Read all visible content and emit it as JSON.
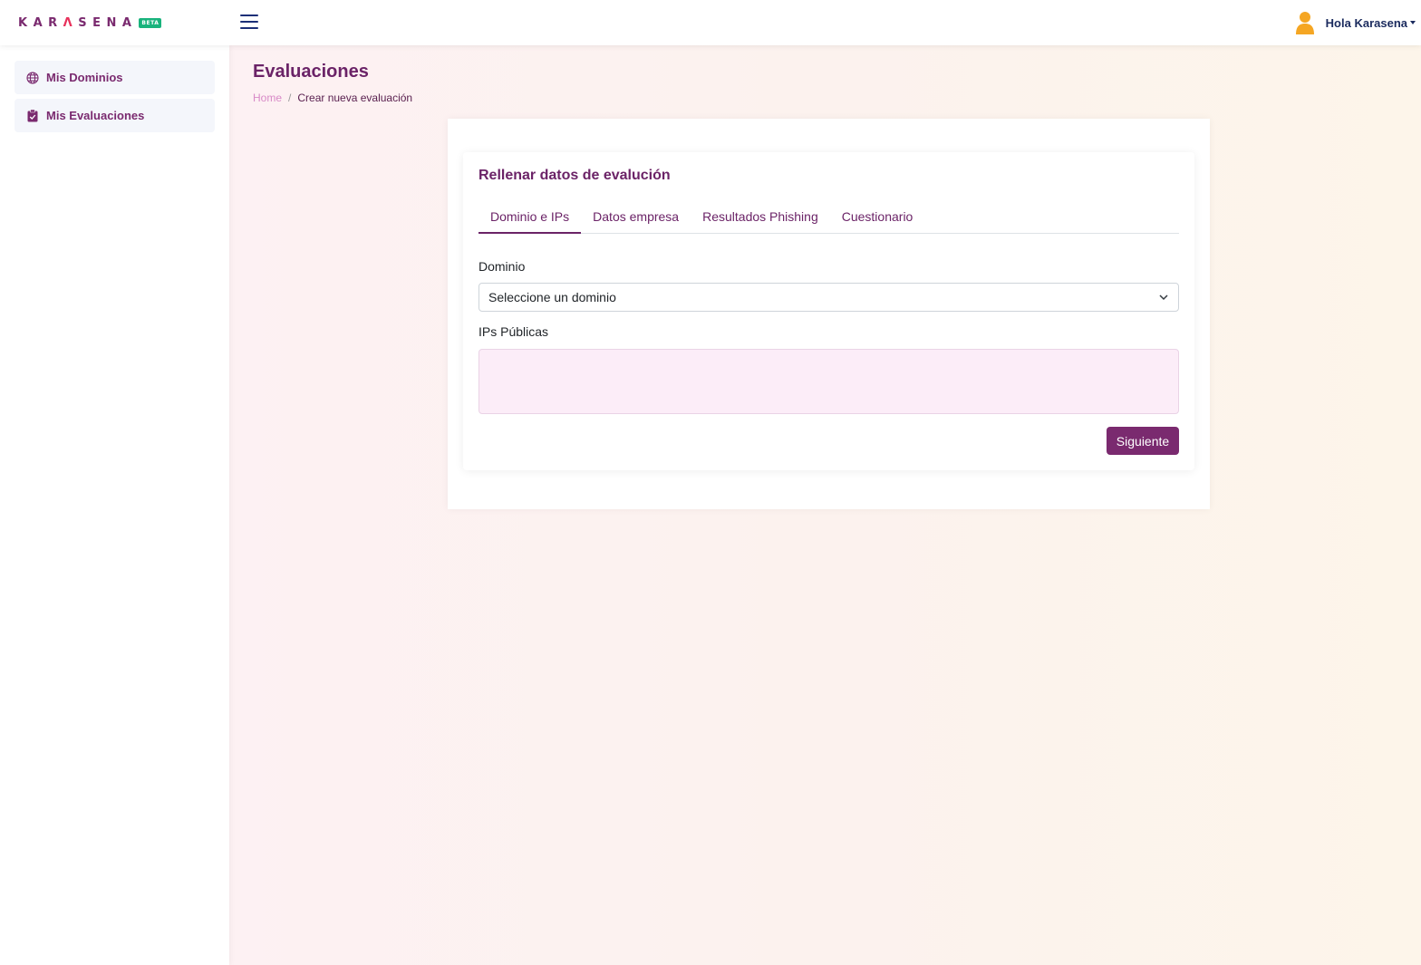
{
  "header": {
    "logo_before": "KAR",
    "logo_accent": "Λ",
    "logo_after": "SENA",
    "beta_badge": "BETA",
    "menu_icon": "hamburger-icon",
    "user_icon": "user-icon",
    "user_greeting": "Hola Karasena"
  },
  "sidebar": {
    "items": [
      {
        "label": "Mis Dominios",
        "icon": "globe-icon"
      },
      {
        "label": "Mis Evaluaciones",
        "icon": "clipboard-check-icon"
      }
    ]
  },
  "page": {
    "title": "Evaluaciones",
    "breadcrumb": {
      "home": "Home",
      "separator": "/",
      "current": "Crear nueva evaluación"
    }
  },
  "form": {
    "title": "Rellenar datos de evalución",
    "tabs": [
      {
        "label": "Dominio e IPs",
        "active": true
      },
      {
        "label": "Datos empresa",
        "active": false
      },
      {
        "label": "Resultados Phishing",
        "active": false
      },
      {
        "label": "Cuestionario",
        "active": false
      }
    ],
    "domain_label": "Dominio",
    "domain_select_value": "Seleccione un dominio",
    "ips_label": "IPs Públicas",
    "ips_value": "",
    "next_button": "Siguiente"
  },
  "colors": {
    "brand": "#7a2a6f",
    "logo_accent": "#e8315b",
    "beta": "#19b37c",
    "user_icon": "#f5a623",
    "nav_dark": "#1c2f77"
  }
}
